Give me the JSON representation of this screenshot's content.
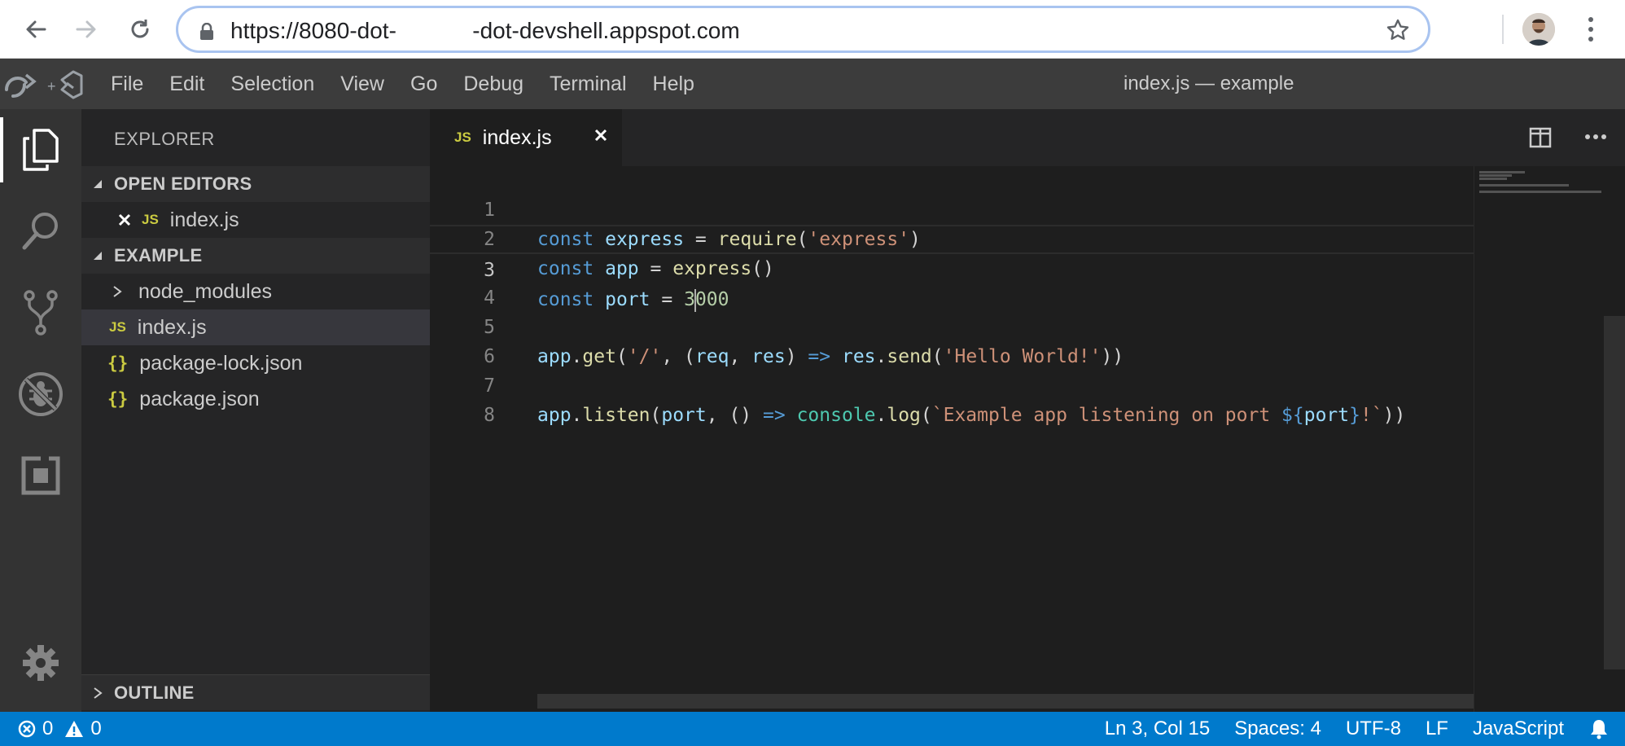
{
  "browser": {
    "url": "https://8080-dot-            -dot-devshell.appspot.com"
  },
  "menubar": {
    "items": [
      "File",
      "Edit",
      "Selection",
      "View",
      "Go",
      "Debug",
      "Terminal",
      "Help"
    ],
    "window_title": "index.js — example"
  },
  "sidebar": {
    "title": "EXPLORER",
    "open_editors_label": "OPEN EDITORS",
    "open_editors": [
      {
        "badge": "JS",
        "name": "index.js"
      }
    ],
    "folder_label": "EXAMPLE",
    "files": [
      {
        "badge": "",
        "name": "node_modules"
      },
      {
        "badge": "JS",
        "name": "index.js"
      },
      {
        "badge": "{}",
        "name": "package-lock.json"
      },
      {
        "badge": "{}",
        "name": "package.json"
      }
    ],
    "outline_label": "OUTLINE"
  },
  "editor": {
    "tab": {
      "badge": "JS",
      "label": "index.js"
    },
    "line_numbers": [
      "1",
      "2",
      "3",
      "4",
      "5",
      "6",
      "7",
      "8"
    ],
    "current_line": 3
  },
  "status": {
    "errors": "0",
    "warnings": "0",
    "position": "Ln 3, Col 15",
    "spaces": "Spaces: 4",
    "encoding": "UTF-8",
    "eol": "LF",
    "language": "JavaScript"
  },
  "colors": {
    "statusbar": "#007acc",
    "keyword": "#569cd6",
    "string": "#ce9178",
    "function": "#dcdcaa",
    "js_icon": "#cbcb41"
  },
  "icons": [
    "back-icon",
    "forward-icon",
    "reload-icon",
    "lock-icon",
    "star-icon",
    "explorer-icon",
    "search-icon",
    "source-control-icon",
    "debug-icon",
    "extensions-icon",
    "settings-gear-icon",
    "split-editor-icon",
    "more-actions-icon",
    "bell-icon"
  ]
}
